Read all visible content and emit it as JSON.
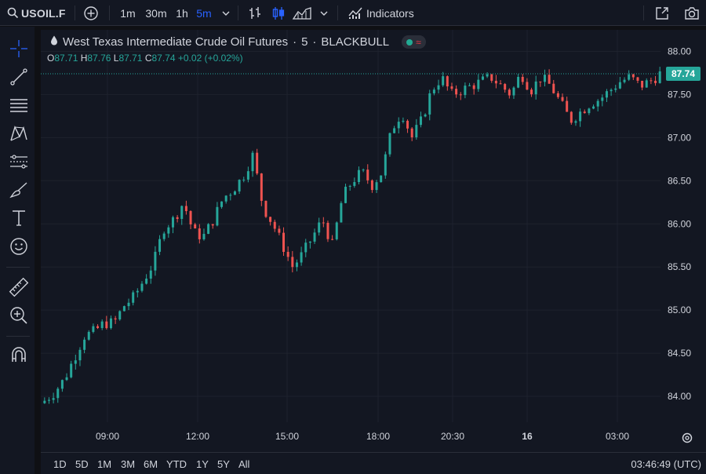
{
  "toolbar": {
    "symbol": "USOIL.F",
    "timeframes": [
      "1m",
      "30m",
      "1h",
      "5m"
    ],
    "active_timeframe": "5m",
    "indicators_label": "Indicators"
  },
  "legend": {
    "title": "West Texas Intermediate Crude Oil Futures",
    "interval": "5",
    "source": "BLACKBULL",
    "separator": "·",
    "open_label": "O",
    "open": "87.71",
    "high_label": "H",
    "high": "87.76",
    "low_label": "L",
    "low": "87.71",
    "close_label": "C",
    "close": "87.74",
    "change": "+0.02 (+0.02%)",
    "wave_icon": "≈"
  },
  "range_buttons": [
    "1D",
    "5D",
    "1M",
    "3M",
    "6M",
    "YTD",
    "1Y",
    "5Y",
    "All"
  ],
  "clock": "03:46:49 (UTC)",
  "colors": {
    "up": "#26a69a",
    "down": "#ef5350",
    "accent": "#2962ff",
    "background": "#131722",
    "grid": "#1e222d"
  },
  "chart_data": {
    "type": "candlestick",
    "ylim": [
      83.7,
      88.25
    ],
    "y_ticks": [
      84.0,
      84.5,
      85.0,
      85.5,
      86.0,
      86.5,
      87.0,
      87.5,
      88.0
    ],
    "y_tick_labels": [
      "84.00",
      "84.50",
      "85.00",
      "85.50",
      "86.00",
      "86.50",
      "87.00",
      "87.50",
      "88.00"
    ],
    "x_tick_labels": [
      "09:00",
      "12:00",
      "15:00",
      "18:00",
      "20:30",
      "16",
      "03:00"
    ],
    "x_tick_bold": [
      false,
      false,
      false,
      false,
      false,
      true,
      false
    ],
    "last_price": 87.74,
    "last_price_label": "87.74",
    "grid": true,
    "close_path": [
      [
        0,
        83.95
      ],
      [
        2,
        84.05
      ],
      [
        4,
        84.2
      ],
      [
        6,
        84.45
      ],
      [
        8,
        84.7
      ],
      [
        10,
        84.75
      ],
      [
        12,
        84.85
      ],
      [
        14,
        84.85
      ],
      [
        16,
        85.05
      ],
      [
        18,
        85.15
      ],
      [
        20,
        85.35
      ],
      [
        22,
        85.55
      ],
      [
        24,
        85.95
      ],
      [
        26,
        86.05
      ],
      [
        28,
        86.25
      ],
      [
        30,
        85.9
      ],
      [
        32,
        85.85
      ],
      [
        34,
        86.05
      ],
      [
        36,
        86.3
      ],
      [
        38,
        86.4
      ],
      [
        40,
        86.55
      ],
      [
        42,
        86.8
      ],
      [
        44,
        86.2
      ],
      [
        46,
        86.0
      ],
      [
        48,
        85.75
      ],
      [
        50,
        85.5
      ],
      [
        52,
        85.65
      ],
      [
        54,
        85.85
      ],
      [
        56,
        86.05
      ],
      [
        58,
        85.75
      ],
      [
        60,
        86.3
      ],
      [
        62,
        86.5
      ],
      [
        64,
        86.6
      ],
      [
        66,
        86.45
      ],
      [
        68,
        86.6
      ],
      [
        70,
        87.1
      ],
      [
        72,
        87.3
      ],
      [
        74,
        87.0
      ],
      [
        76,
        87.2
      ],
      [
        78,
        87.55
      ],
      [
        80,
        87.7
      ],
      [
        82,
        87.5
      ],
      [
        84,
        87.55
      ],
      [
        86,
        87.6
      ],
      [
        88,
        87.65
      ],
      [
        90,
        87.7
      ],
      [
        92,
        87.6
      ],
      [
        94,
        87.5
      ],
      [
        96,
        87.75
      ],
      [
        98,
        87.55
      ],
      [
        100,
        87.7
      ],
      [
        102,
        87.6
      ],
      [
        104,
        87.4
      ],
      [
        106,
        87.2
      ],
      [
        108,
        87.3
      ],
      [
        110,
        87.4
      ],
      [
        112,
        87.45
      ],
      [
        114,
        87.55
      ],
      [
        116,
        87.65
      ],
      [
        118,
        87.7
      ],
      [
        120,
        87.6
      ],
      [
        122,
        87.65
      ],
      [
        124,
        87.74
      ]
    ]
  }
}
